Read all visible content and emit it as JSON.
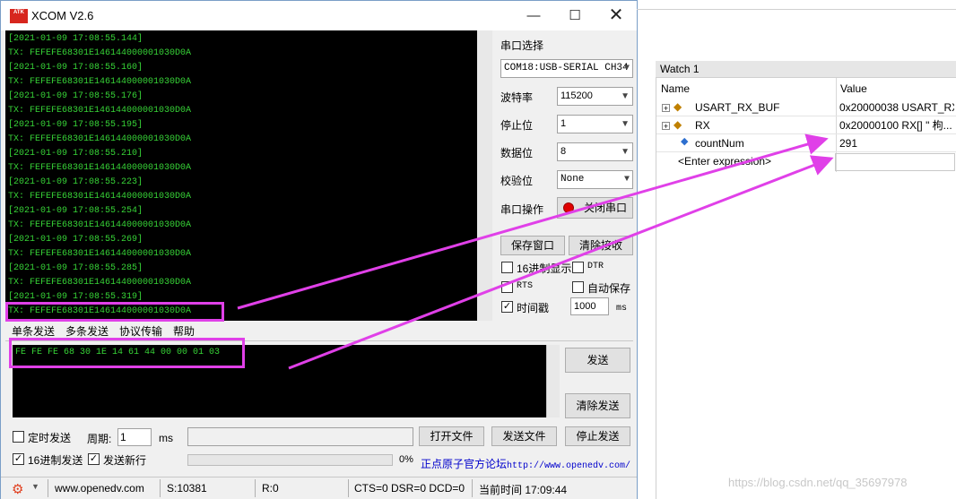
{
  "window": {
    "logo_text": "ATK",
    "title": "XCOM V2.6",
    "controls": {
      "minimize": "—",
      "maximize": "☐",
      "close": "✕"
    }
  },
  "receive_lines": [
    "[2021-01-09 17:08:55.144]",
    "TX: FEFEFE68301E146144000001030D0A",
    "[2021-01-09 17:08:55.160]",
    "TX: FEFEFE68301E146144000001030D0A",
    "[2021-01-09 17:08:55.176]",
    "TX: FEFEFE68301E146144000001030D0A",
    "[2021-01-09 17:08:55.195]",
    "TX: FEFEFE68301E146144000001030D0A",
    "[2021-01-09 17:08:55.210]",
    "TX: FEFEFE68301E146144000001030D0A",
    "[2021-01-09 17:08:55.223]",
    "TX: FEFEFE68301E146144000001030D0A",
    "[2021-01-09 17:08:55.254]",
    "TX: FEFEFE68301E146144000001030D0A",
    "[2021-01-09 17:08:55.269]",
    "TX: FEFEFE68301E146144000001030D0A",
    "[2021-01-09 17:08:55.285]",
    "TX: FEFEFE68301E146144000001030D0A",
    "[2021-01-09 17:08:55.319]",
    "TX: FEFEFE68301E146144000001030D0A"
  ],
  "settings": {
    "port_label": "串口选择",
    "port_value": "COM18:USB-SERIAL CH34",
    "baud_label": "波特率",
    "baud_value": "115200",
    "stop_label": "停止位",
    "stop_value": "1",
    "data_label": "数据位",
    "data_value": "8",
    "parity_label": "校验位",
    "parity_value": "None",
    "op_label": "串口操作",
    "op_button": "关闭串口",
    "save_window": "保存窗口",
    "clear_receive": "清除接收",
    "hex_display": "16进制显示",
    "dtr": "DTR",
    "rts": "RTS",
    "auto_save": "自动保存",
    "timestamp": "时间戳",
    "timestamp_value": "1000",
    "timestamp_unit": "ms"
  },
  "tabs": [
    "单条发送",
    "多条发送",
    "协议传输",
    "帮助"
  ],
  "send": {
    "text": "FE FE FE 68 30 1E 14 61 44 00 00 01 03",
    "send_button": "发送",
    "clear_send_button": "清除发送"
  },
  "bottom": {
    "timed_send": "定时发送",
    "period_label": "周期:",
    "period_value": "1",
    "period_unit": "ms",
    "open_file": "打开文件",
    "send_file": "发送文件",
    "stop_send": "停止发送",
    "hex_send": "16进制发送",
    "send_newline": "发送新行",
    "progress_percent": "0%",
    "progress_value": 0,
    "forum_text": "正点原子官方论坛",
    "forum_url": "http://www.openedv.com/"
  },
  "statusbar": {
    "site": "www.openedv.com",
    "s_count": "S:10381",
    "r_count": "R:0",
    "lines": "CTS=0 DSR=0 DCD=0",
    "time": "当前时间 17:09:44"
  },
  "watch": {
    "title": "Watch 1",
    "col_name": "Name",
    "col_value": "Value",
    "rows": [
      {
        "name": "USART_RX_BUF",
        "value": "0x20000038 USART_RX..."
      },
      {
        "name": "RX",
        "value": "0x20000100 RX[] \"   枸..."
      },
      {
        "name": "countNum",
        "value": "291"
      },
      {
        "name": "<Enter expression>",
        "value": ""
      }
    ]
  },
  "watermark": "https://blog.csdn.net/qq_35697978",
  "colors": {
    "terminal_bg": "#000000",
    "terminal_text": "#37d437",
    "annotation": "#e040e8",
    "link": "#0000cc"
  }
}
